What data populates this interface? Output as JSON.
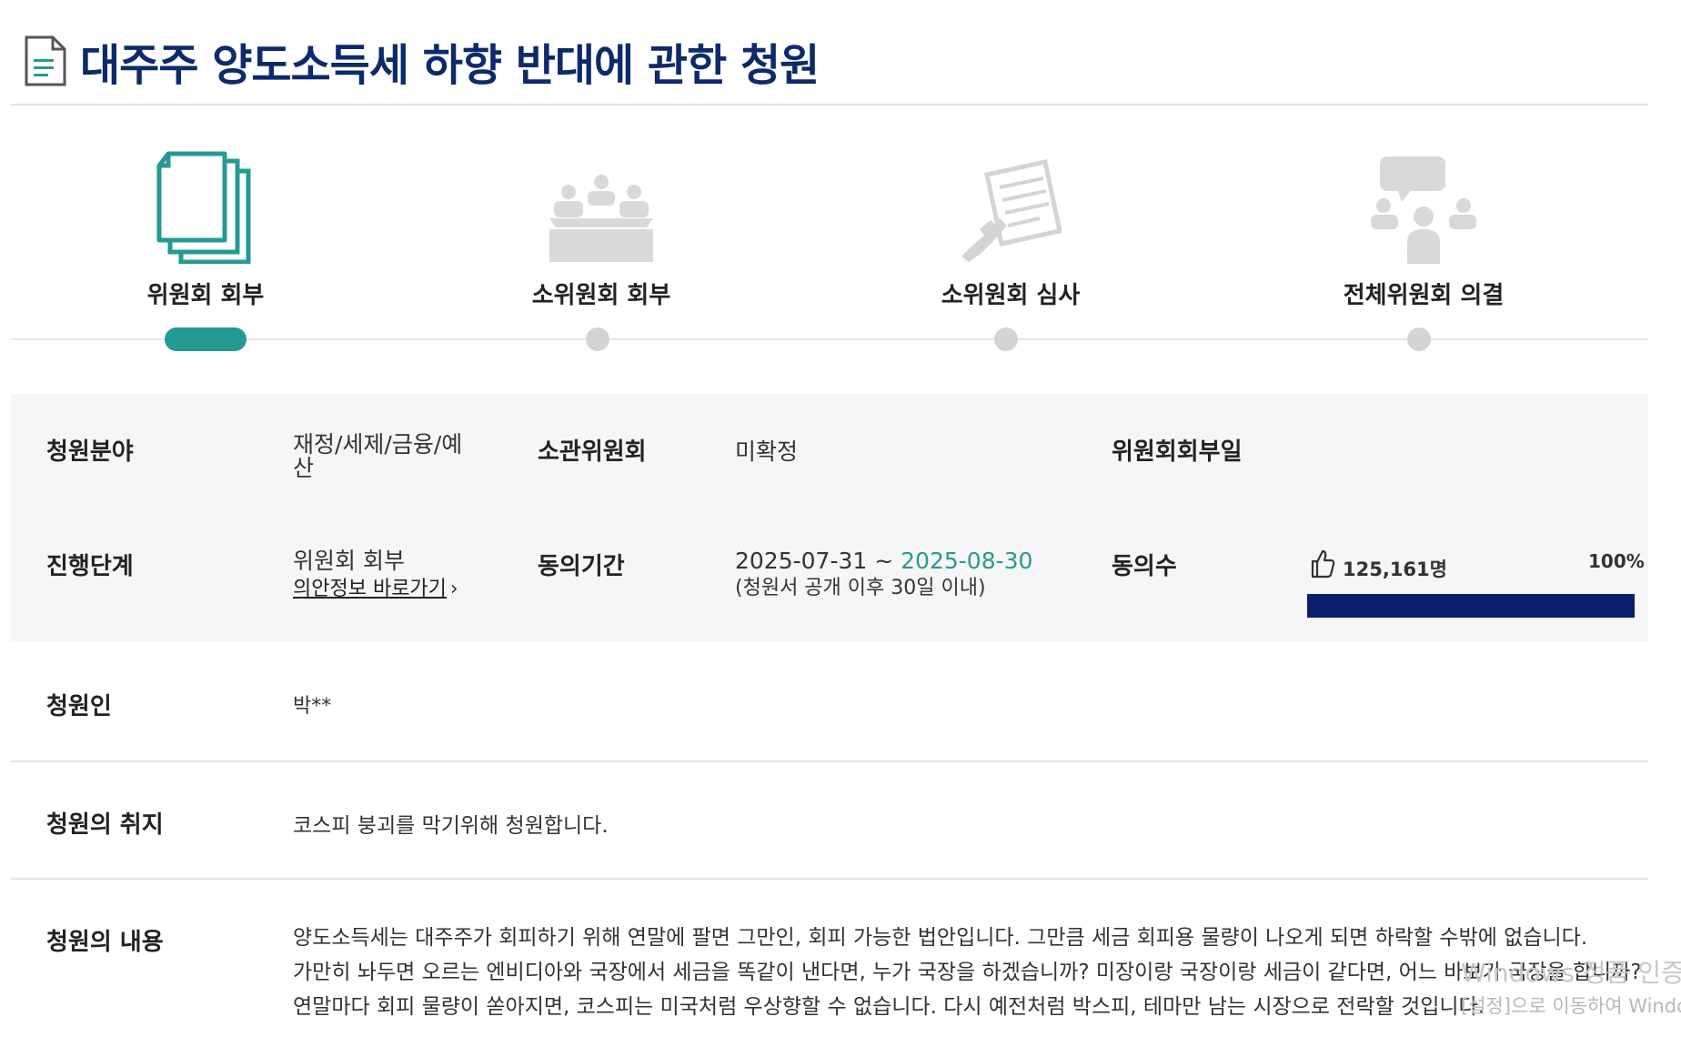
{
  "header": {
    "title": "대주주 양도소득세 하향 반대에 관한 청원"
  },
  "steps": [
    {
      "label": "위원회 회부",
      "icon": "documents-icon",
      "active": true
    },
    {
      "label": "소위원회 회부",
      "icon": "meeting-icon",
      "active": false
    },
    {
      "label": "소위원회 심사",
      "icon": "review-document-icon",
      "active": false
    },
    {
      "label": "전체위원회 의결",
      "icon": "discussion-icon",
      "active": false
    }
  ],
  "info": {
    "field_label": "청원분야",
    "field_value_1": "재정/세제/금융/예",
    "field_value_2": "산",
    "committee_label": "소관위원회",
    "committee_value": "미확정",
    "referral_date_label": "위원회회부일",
    "stage_label": "진행단계",
    "stage_value": "위원회 회부",
    "bill_link": "의안정보 바로가기",
    "period_label": "동의기간",
    "period_start": "2025-07-31 ~ ",
    "period_end": "2025-08-30",
    "period_note": "(청원서 공개 이후 30일 이내)",
    "agree_label": "동의수",
    "agree_count": "125,161명",
    "agree_percent": "100%",
    "agree_progress": 1.0
  },
  "petitioner": {
    "label": "청원인",
    "value": "박**"
  },
  "purpose": {
    "label": "청원의 취지",
    "value": "코스피 붕괴를 막기위해 청원합니다."
  },
  "content": {
    "label": "청원의 내용",
    "lines": [
      "양도소득세는 대주주가 회피하기 위해 연말에 팔면 그만인, 회피 가능한 법안입니다. 그만큼 세금 회피용 물량이 나오게 되면 하락할 수밖에 없습니다.",
      "가만히 놔두면 오르는 엔비디아와 국장에서 세금을 똑같이 낸다면, 누가 국장을 하겠습니까? 미장이랑 국장이랑 세금이 같다면, 어느 바보가 국장을 합니까?",
      "연말마다 회피 물량이 쏟아지면, 코스피는 미국처럼 우상향할 수 없습니다. 다시 예전처럼 박스피, 테마만 남는 시장으로 전락할 것입니다."
    ]
  },
  "overlay": {
    "watermark_line1": "Windows 정품 인증",
    "watermark_line2": "[설정]으로 이동하여 Windows를"
  },
  "colors": {
    "title": "#0d2a6b",
    "accent": "#259a92",
    "progress": "#0a1f6b"
  }
}
